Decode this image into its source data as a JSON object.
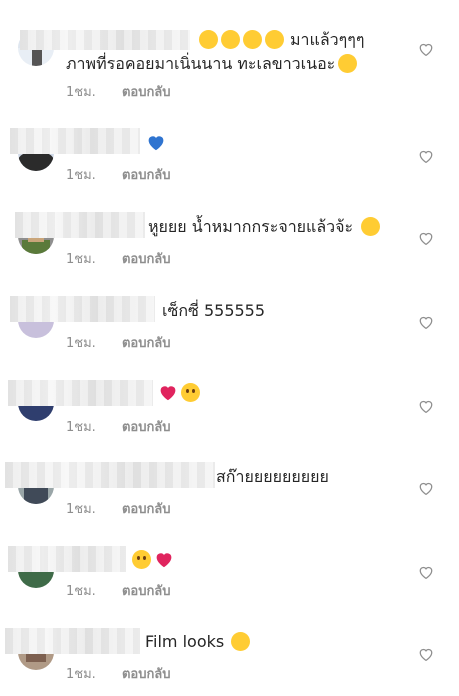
{
  "comments": [
    {
      "text": "มาแล้วๆๆๆ",
      "line2": "ภาพที่รอคอยมาเนิ่นนาน ทะเลขาวเนอะ",
      "time": "1ชม.",
      "reply": "ตอบกลับ"
    },
    {
      "text": "",
      "time": "1ชม.",
      "reply": "ตอบกลับ"
    },
    {
      "text": "หูยยย น้ำหมากกระจายแล้วจ้ะ",
      "time": "1ชม.",
      "reply": "ตอบกลับ"
    },
    {
      "text": "เซ็กซี่ 555555",
      "time": "1ชม.",
      "reply": "ตอบกลับ"
    },
    {
      "text": "",
      "time": "1ชม.",
      "reply": "ตอบกลับ"
    },
    {
      "text": "สก๊ายยยยยยยยย",
      "time": "1ชม.",
      "reply": "ตอบกลับ"
    },
    {
      "text": "",
      "time": "1ชม.",
      "reply": "ตอบกลับ"
    },
    {
      "text": "Film looks",
      "time": "1ชม.",
      "reply": "ตอบกลับ"
    }
  ],
  "colors": {
    "meta": "#8e8e8e",
    "heart_red": "#e0245e",
    "heart_blue": "#2f74d0",
    "emoji_yellow": "#ffcc33"
  }
}
